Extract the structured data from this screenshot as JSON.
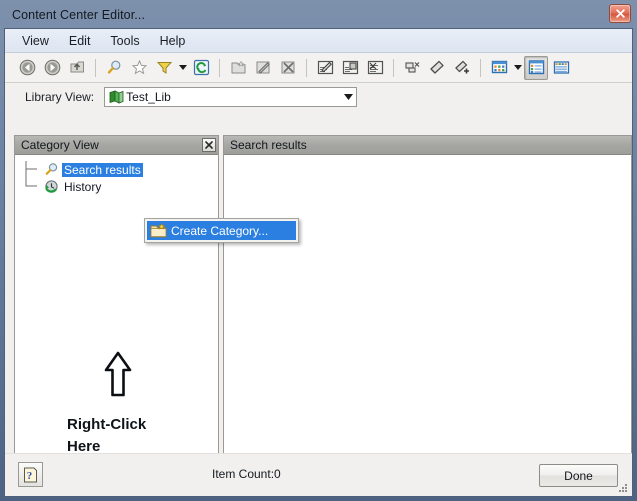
{
  "window": {
    "title": "Content Center Editor...",
    "close_button": "x"
  },
  "menubar": {
    "items": [
      {
        "label": "View"
      },
      {
        "label": "Edit"
      },
      {
        "label": "Tools"
      },
      {
        "label": "Help"
      }
    ]
  },
  "toolbar": {
    "groups": [
      {
        "buttons": [
          {
            "icon": "back-arrow-icon",
            "enabled": true
          },
          {
            "icon": "forward-arrow-icon",
            "enabled": true
          },
          {
            "icon": "go-up-icon",
            "enabled": false
          }
        ]
      },
      {
        "buttons": [
          {
            "icon": "search-magnifier-icon",
            "enabled": true
          },
          {
            "icon": "favorites-star-icon",
            "enabled": false
          },
          {
            "icon": "filter-funnel-icon",
            "enabled": true,
            "has_dropdown": true
          },
          {
            "icon": "refresh-icon",
            "enabled": true
          }
        ]
      },
      {
        "buttons": [
          {
            "icon": "new-folder-icon",
            "enabled": false
          },
          {
            "icon": "edit-folder-icon",
            "enabled": false
          },
          {
            "icon": "delete-folder-icon",
            "enabled": false
          }
        ]
      },
      {
        "buttons": [
          {
            "icon": "edit-family-icon",
            "enabled": false
          },
          {
            "icon": "copy-family-icon",
            "enabled": false
          },
          {
            "icon": "family-table-icon",
            "enabled": false
          }
        ]
      },
      {
        "buttons": [
          {
            "icon": "cut-member-icon",
            "enabled": false
          },
          {
            "icon": "publish-icon",
            "enabled": false
          },
          {
            "icon": "add-member-icon",
            "enabled": false
          }
        ]
      },
      {
        "buttons": [
          {
            "icon": "view-options-icon",
            "enabled": true,
            "has_dropdown": true
          },
          {
            "icon": "list-view-icon",
            "enabled": true,
            "pressed": true
          },
          {
            "icon": "details-view-icon",
            "enabled": true
          }
        ]
      }
    ]
  },
  "library_view": {
    "label": "Library View:",
    "selected": "Test_Lib",
    "icon": "library-book-icon",
    "dropdown_icon": "chevron-down-icon"
  },
  "left_pane": {
    "header": "Category View",
    "close_icon": "close-icon",
    "tree": [
      {
        "label": "Search results",
        "icon": "search-magnifier-icon",
        "selected": true
      },
      {
        "label": "History",
        "icon": "history-clock-icon",
        "selected": false
      }
    ]
  },
  "right_pane": {
    "header": "Search results",
    "items": []
  },
  "context_menu": {
    "items": [
      {
        "label": "Create Category...",
        "icon": "new-folder-icon",
        "highlighted": true
      }
    ]
  },
  "annotation": {
    "arrow_icon": "up-arrow-annotation",
    "line1": "Right-Click",
    "line2": "Here"
  },
  "bottom_bar": {
    "help_icon": "help-question-icon",
    "item_count": "Item Count:0",
    "done_label": "Done",
    "resize_grip_icon": "resize-grip-icon"
  },
  "colors": {
    "title_bar": "#6b82a3",
    "selection_blue": "#2a7fe0",
    "pane_header_gray": "#a6a6a2",
    "close_button_red": "#e2705a",
    "client_background": "#f1f0ef"
  }
}
